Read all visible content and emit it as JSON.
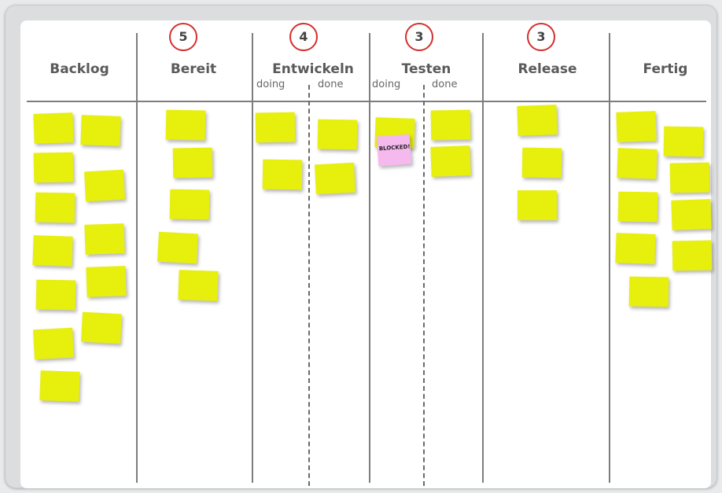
{
  "board": {
    "columns": [
      {
        "name": "Backlog",
        "wip": null
      },
      {
        "name": "Bereit",
        "wip": "5"
      },
      {
        "name": "Entwickeln",
        "wip": "4",
        "subcolumns": [
          "doing",
          "done"
        ]
      },
      {
        "name": "Testen",
        "wip": "3",
        "subcolumns": [
          "doing",
          "done"
        ]
      },
      {
        "name": "Release",
        "wip": "3"
      },
      {
        "name": "Fertig",
        "wip": null
      }
    ],
    "blocked_label": "BLOCKED!",
    "colors": {
      "sticky_note": "#e7ef0d",
      "blocked_note": "#f5b9ee",
      "wip_circle": "#d32f2f",
      "board": "#ffffff",
      "frame": "#dcdddf"
    }
  }
}
